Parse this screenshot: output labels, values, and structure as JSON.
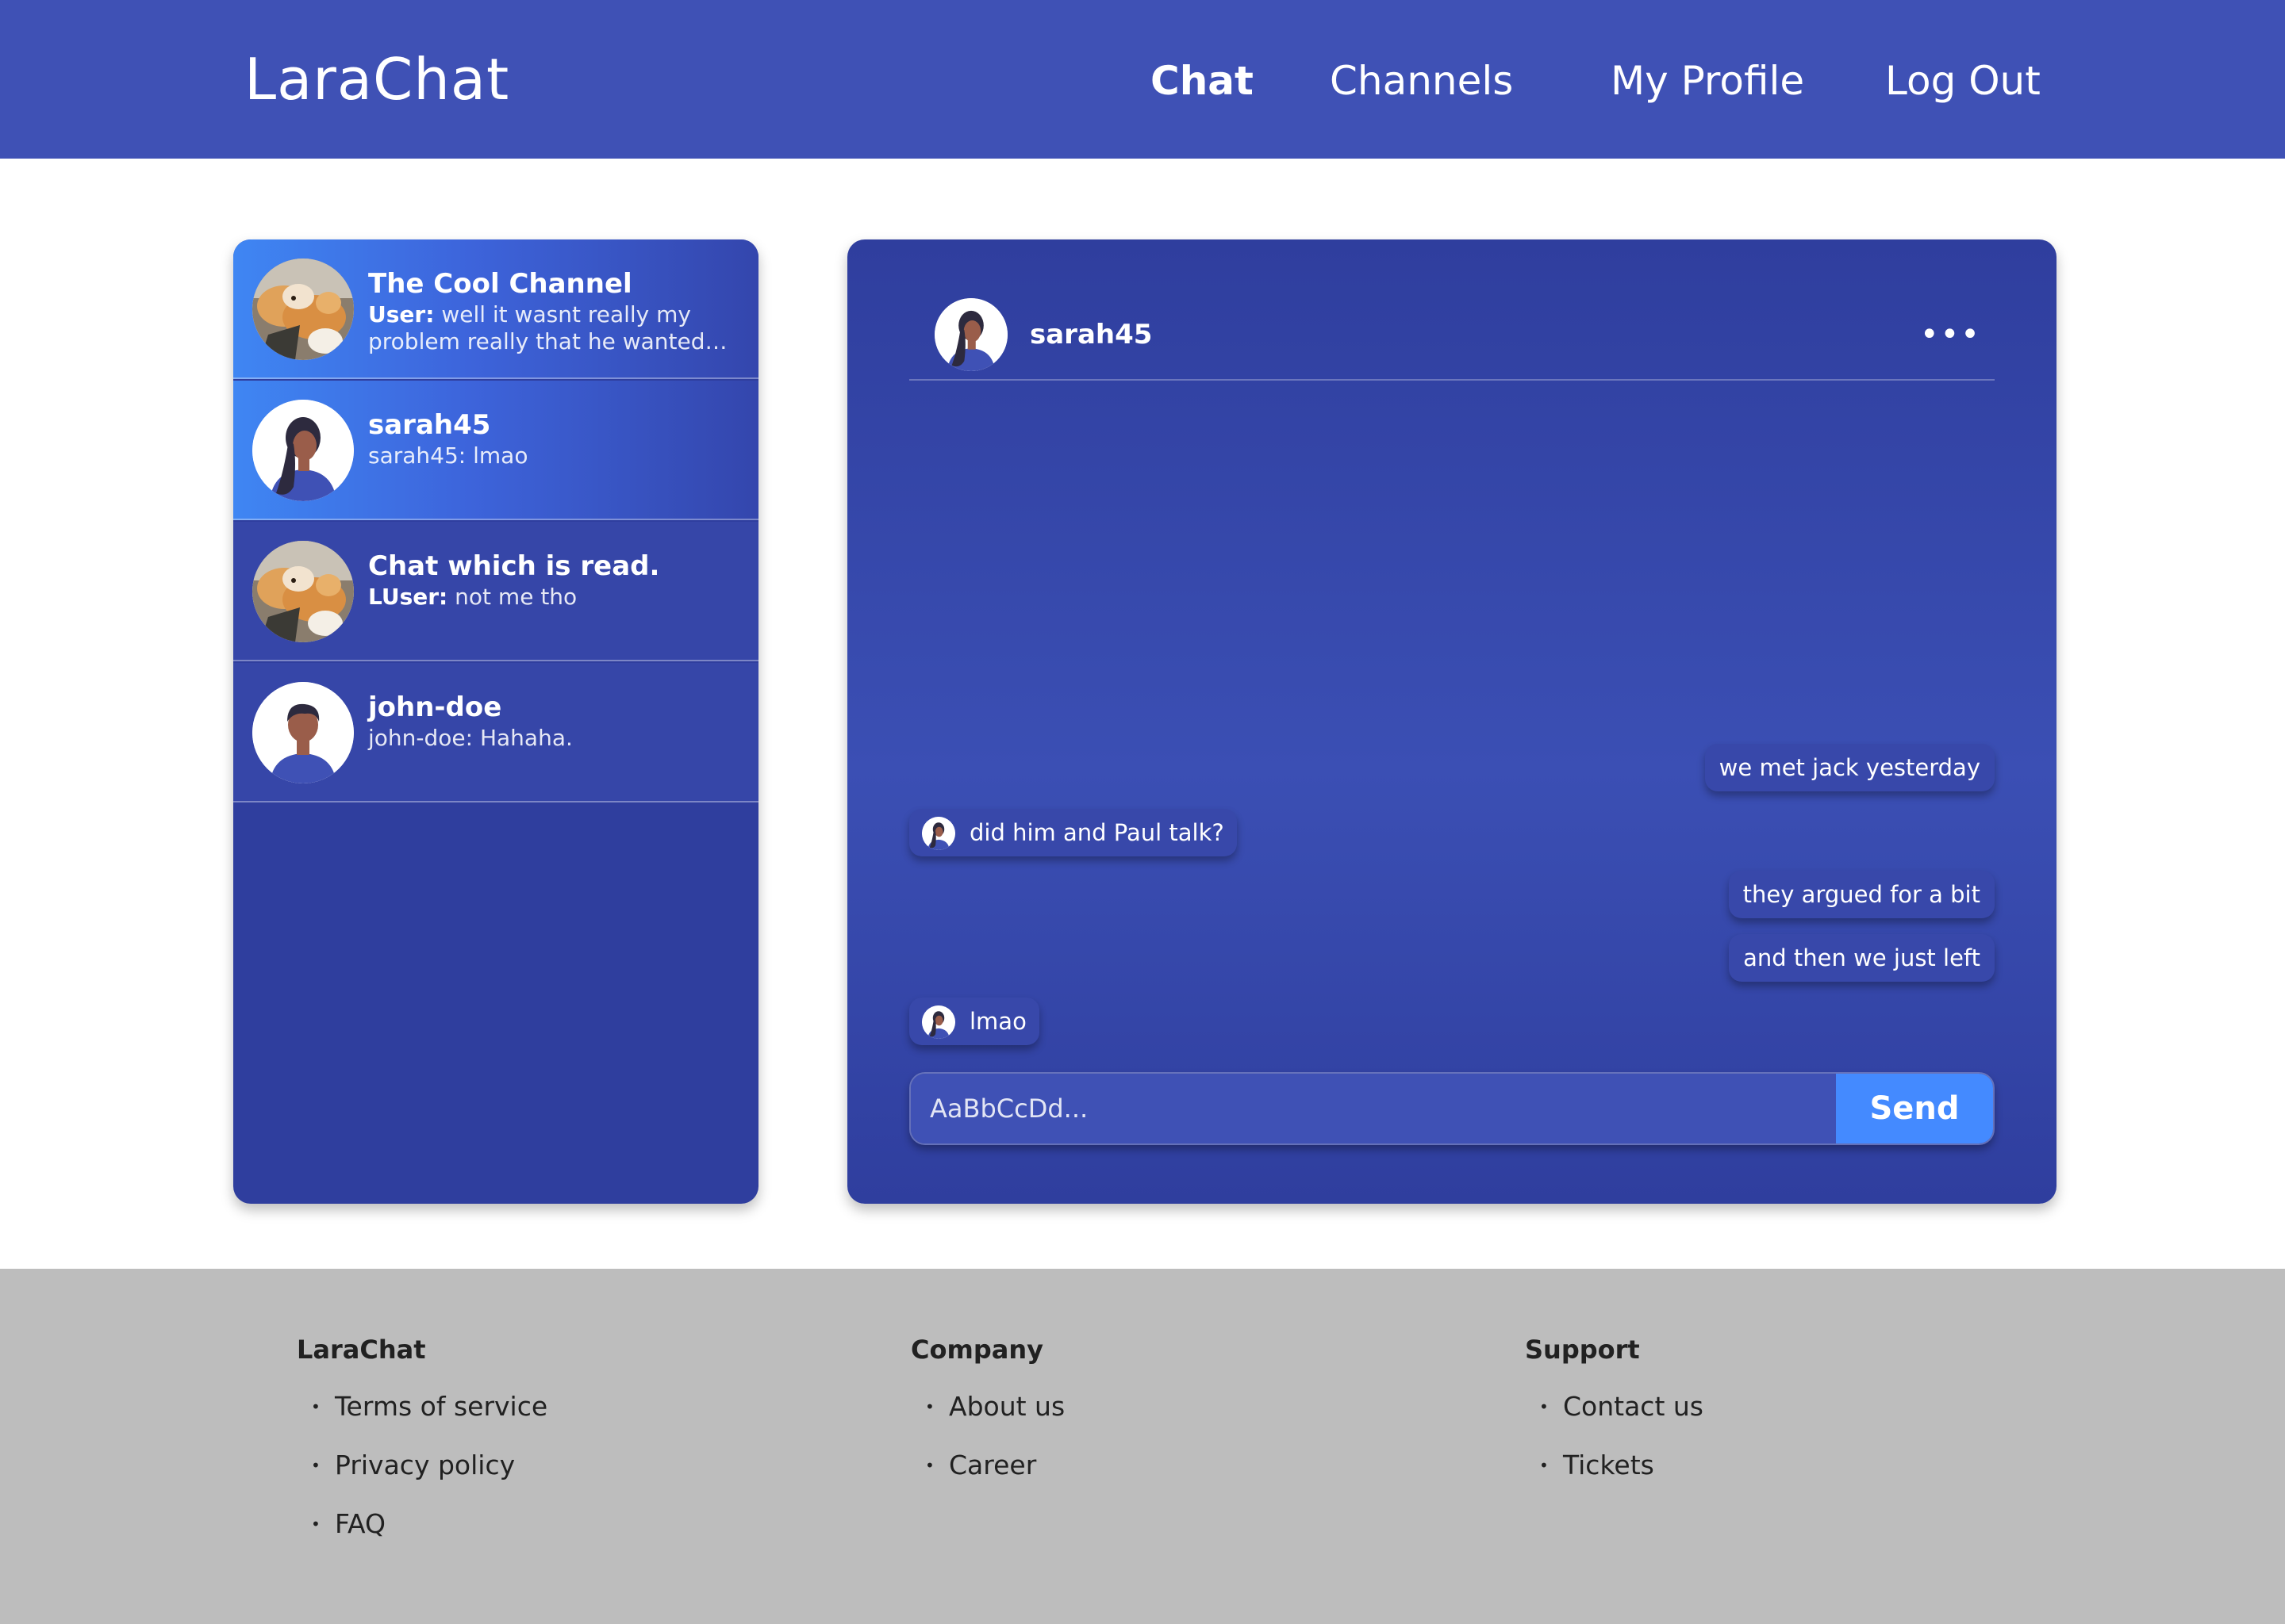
{
  "navbar": {
    "brand": "LaraChat",
    "links": {
      "chat": "Chat",
      "channels": "Channels",
      "my_profile": "My Profile",
      "log_out": "Log Out"
    },
    "active": "Chat",
    "background": "#3f51b5"
  },
  "sidebar": {
    "items": [
      {
        "title": "The Cool Channel",
        "sender": "User:",
        "preview": "well it wasnt really my problem really that he wanted t...",
        "avatar": "dog-photo",
        "state": "highlighted"
      },
      {
        "title": "sarah45",
        "sender": "",
        "preview": "sarah45: lmao",
        "avatar": "woman-icon",
        "state": "active"
      },
      {
        "title": "Chat which is read.",
        "sender": "LUser:",
        "preview": "not me tho",
        "avatar": "dog-photo",
        "state": "read"
      },
      {
        "title": "john-doe",
        "sender": "",
        "preview": "john-doe: Hahaha.",
        "avatar": "man-icon",
        "state": "read"
      }
    ]
  },
  "chat": {
    "header_name": "sarah45",
    "more_icon": "more-horizontal-icon",
    "messages": [
      {
        "text": "we met jack yesterday",
        "direction": "outgoing"
      },
      {
        "text": "did him and Paul talk?",
        "direction": "incoming"
      },
      {
        "text": "they argued for a bit",
        "direction": "outgoing"
      },
      {
        "text": "and then we just left",
        "direction": "outgoing"
      },
      {
        "text": "lmao",
        "direction": "incoming"
      }
    ],
    "input_placeholder": "AaBbCcDd...",
    "send_label": "Send",
    "send_color": "#448aff"
  },
  "footer": {
    "columns": [
      {
        "heading": "LaraChat",
        "links": [
          "Terms of service",
          "Privacy policy",
          "FAQ"
        ]
      },
      {
        "heading": "Company",
        "links": [
          "About us",
          "Career"
        ]
      },
      {
        "heading": "Support",
        "links": [
          "Contact us",
          "Tickets"
        ]
      }
    ],
    "background": "#bdbdbd"
  }
}
